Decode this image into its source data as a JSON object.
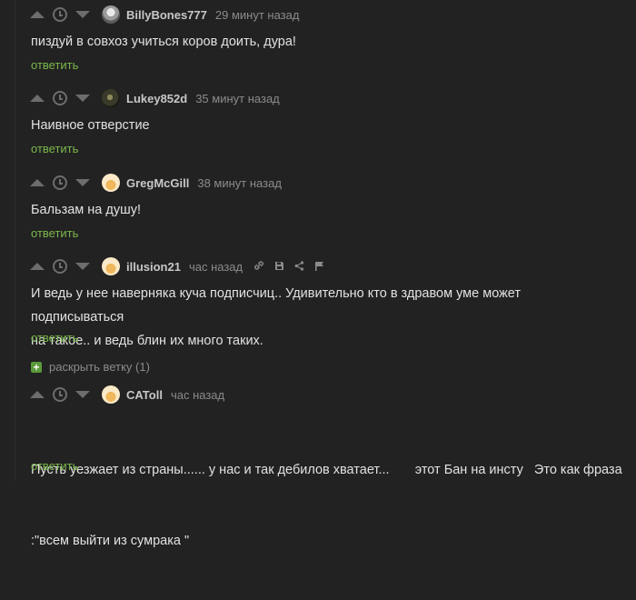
{
  "comments": [
    {
      "author": "BillyBones777",
      "time": "29 минут назад",
      "text": "пиздуй в совхоз учиться коров доить, дура!",
      "reply": "ответить"
    },
    {
      "author": "Lukey852d",
      "time": "35 минут назад",
      "text": "Наивное отверстие",
      "reply": "ответить"
    },
    {
      "author": "GregMcGill",
      "time": "38 минут назад",
      "text": "Бальзам на душу!",
      "reply": "ответить"
    },
    {
      "author": "illusion21",
      "time": "час назад",
      "text_line1": "И ведь у нее наверняка куча подписчиц.. Удивительно кто в здравом уме может подписываться",
      "text_line2": "на такое.. и ведь блин их много таких.",
      "reply": "ответить",
      "actions": [
        "link-icon",
        "save-icon",
        "share-icon",
        "flag-icon"
      ]
    },
    {
      "author": "CAToll",
      "time": "час назад",
      "text_line1": "Пусть уезжает из страны...... у нас и так дебилов хватает...       этот Бан на инсту   Это как фраза",
      "text_line2": ":\"всем выйти из сумрака \"",
      "reply": "ответить"
    }
  ],
  "expand_branch": {
    "label": "раскрыть ветку (1)",
    "icon": "plus-icon"
  },
  "colors": {
    "background": "#222222",
    "reply_link": "#7bb84a",
    "muted": "#8b8b8b",
    "expand_icon": "#5b9b3a"
  }
}
